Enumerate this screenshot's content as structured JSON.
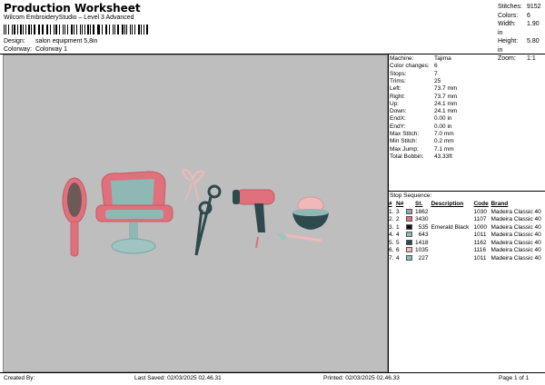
{
  "header": {
    "title": "Production Worksheet",
    "subtitle": "Wilcom EmbroideryStudio – Level 3 Advanced",
    "design_label": "Design:",
    "design_value": "salon equipment 5,8in",
    "colorway_label": "Colorway:",
    "colorway_value": "Colorway 1"
  },
  "stats": [
    {
      "label": "Stitches:",
      "value": "9152"
    },
    {
      "label": "Colors:",
      "value": "6"
    },
    {
      "label": "Width:",
      "value": "1.90 in"
    },
    {
      "label": "Height:",
      "value": "5.80 in"
    },
    {
      "label": "Zoom:",
      "value": "1:1"
    }
  ],
  "machine_info": [
    {
      "label": "Machine:",
      "value": "Tajima"
    },
    {
      "label": "Color changes:",
      "value": "6"
    },
    {
      "label": "Stops:",
      "value": "7"
    },
    {
      "label": "Trims:",
      "value": "25"
    },
    {
      "label": "Left:",
      "value": "73.7 mm"
    },
    {
      "label": "Right:",
      "value": "73.7 mm"
    },
    {
      "label": "Up:",
      "value": "24.1 mm"
    },
    {
      "label": "Down:",
      "value": "24.1 mm"
    },
    {
      "label": "EndX:",
      "value": "0.00 in"
    },
    {
      "label": "EndY:",
      "value": "0.00 in"
    },
    {
      "label": "Max Stitch:",
      "value": "7.0 mm"
    },
    {
      "label": "Min Stitch:",
      "value": "0.2 mm"
    },
    {
      "label": "Max Jump:",
      "value": "7.1 mm"
    },
    {
      "label": "Total Bobbin:",
      "value": "43.33ft"
    }
  ],
  "sequence": {
    "title": "Stop Sequence:",
    "headers": [
      "#",
      "N#",
      "St.",
      "Description",
      "Code",
      "Brand"
    ],
    "rows": [
      {
        "num": "1.",
        "n": "3",
        "color": "#9aa7b3",
        "st": "1862",
        "desc": "",
        "code": "1030",
        "brand": "Madeira Classic 40"
      },
      {
        "num": "2.",
        "n": "2",
        "color": "#e0707c",
        "st": "3430",
        "desc": "",
        "code": "1107",
        "brand": "Madeira Classic 40"
      },
      {
        "num": "3.",
        "n": "1",
        "color": "#111111",
        "st": "535",
        "desc": "Emerald Black",
        "code": "1000",
        "brand": "Madeira Classic 40"
      },
      {
        "num": "4.",
        "n": "4",
        "color": "#8fb7b4",
        "st": "643",
        "desc": "",
        "code": "1011",
        "brand": "Madeira Classic 40"
      },
      {
        "num": "5.",
        "n": "5",
        "color": "#2e4a4c",
        "st": "1418",
        "desc": "",
        "code": "1162",
        "brand": "Madeira Classic 40"
      },
      {
        "num": "6.",
        "n": "6",
        "color": "#f0b8b8",
        "st": "1035",
        "desc": "",
        "code": "1116",
        "brand": "Madeira Classic 40"
      },
      {
        "num": "7.",
        "n": "4",
        "color": "#8fb7b4",
        "st": "227",
        "desc": "",
        "code": "1011",
        "brand": "Madeira Classic 40"
      }
    ]
  },
  "footer": {
    "created": "Created By:",
    "saved": "Last Saved: 02/03/2025 02.46.31",
    "printed": "Printed: 02/03/2025 02.46.33",
    "page": "Page 1 of 1"
  }
}
